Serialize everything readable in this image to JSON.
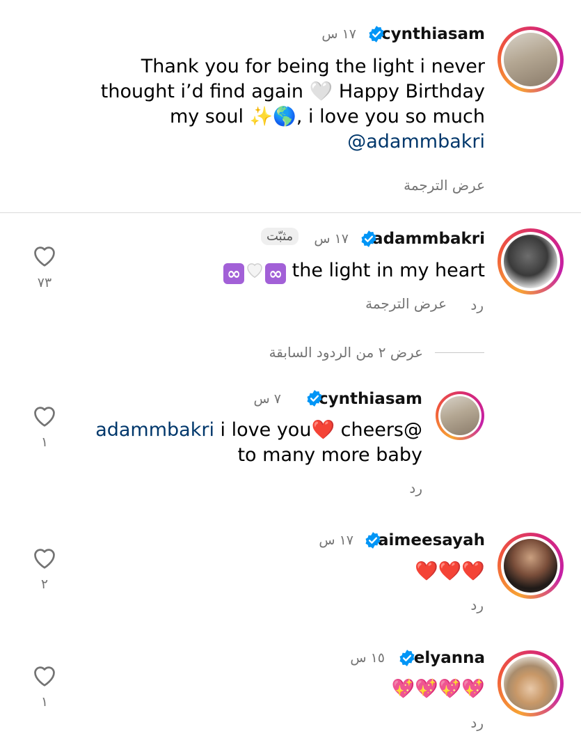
{
  "comments": [
    {
      "username": "cynthiasam",
      "time": "١٧ س",
      "text_line1": "Thank you for being the light i never",
      "text_line2": "thought i’d find again 🤍 Happy Birthday",
      "text_line3": "my soul ✨🌎, i love you so much",
      "mention": "@adammbakri",
      "translate": "عرض الترجمة"
    },
    {
      "username": "adammbakri",
      "time": "١٧ س",
      "pinned": "مثبّت",
      "text": "the light in my heart",
      "reply": "رد",
      "translate": "عرض الترجمة",
      "likes": "٧٣"
    }
  ],
  "view_replies": "عرض ٢ من الردود السابقة",
  "replies": [
    {
      "username": "cynthiasam",
      "time": "٧ س",
      "mention": "adammbakri",
      "text_line1_a": " i love you❤️ cheers@",
      "text_line2": "to many more baby",
      "reply": "رد",
      "likes": "١"
    },
    {
      "username": "aimeesayah",
      "time": "١٧ س",
      "text": "❤️❤️❤️",
      "reply": "رد",
      "likes": "٢"
    },
    {
      "username": "elyanna",
      "time": "١٥ س",
      "text": "💖💖💖💖",
      "reply": "رد",
      "likes": "١"
    }
  ],
  "colors": {
    "verified": "#0095f6",
    "mention": "#00376b",
    "muted": "#737373",
    "infinity": "#a260d7"
  }
}
